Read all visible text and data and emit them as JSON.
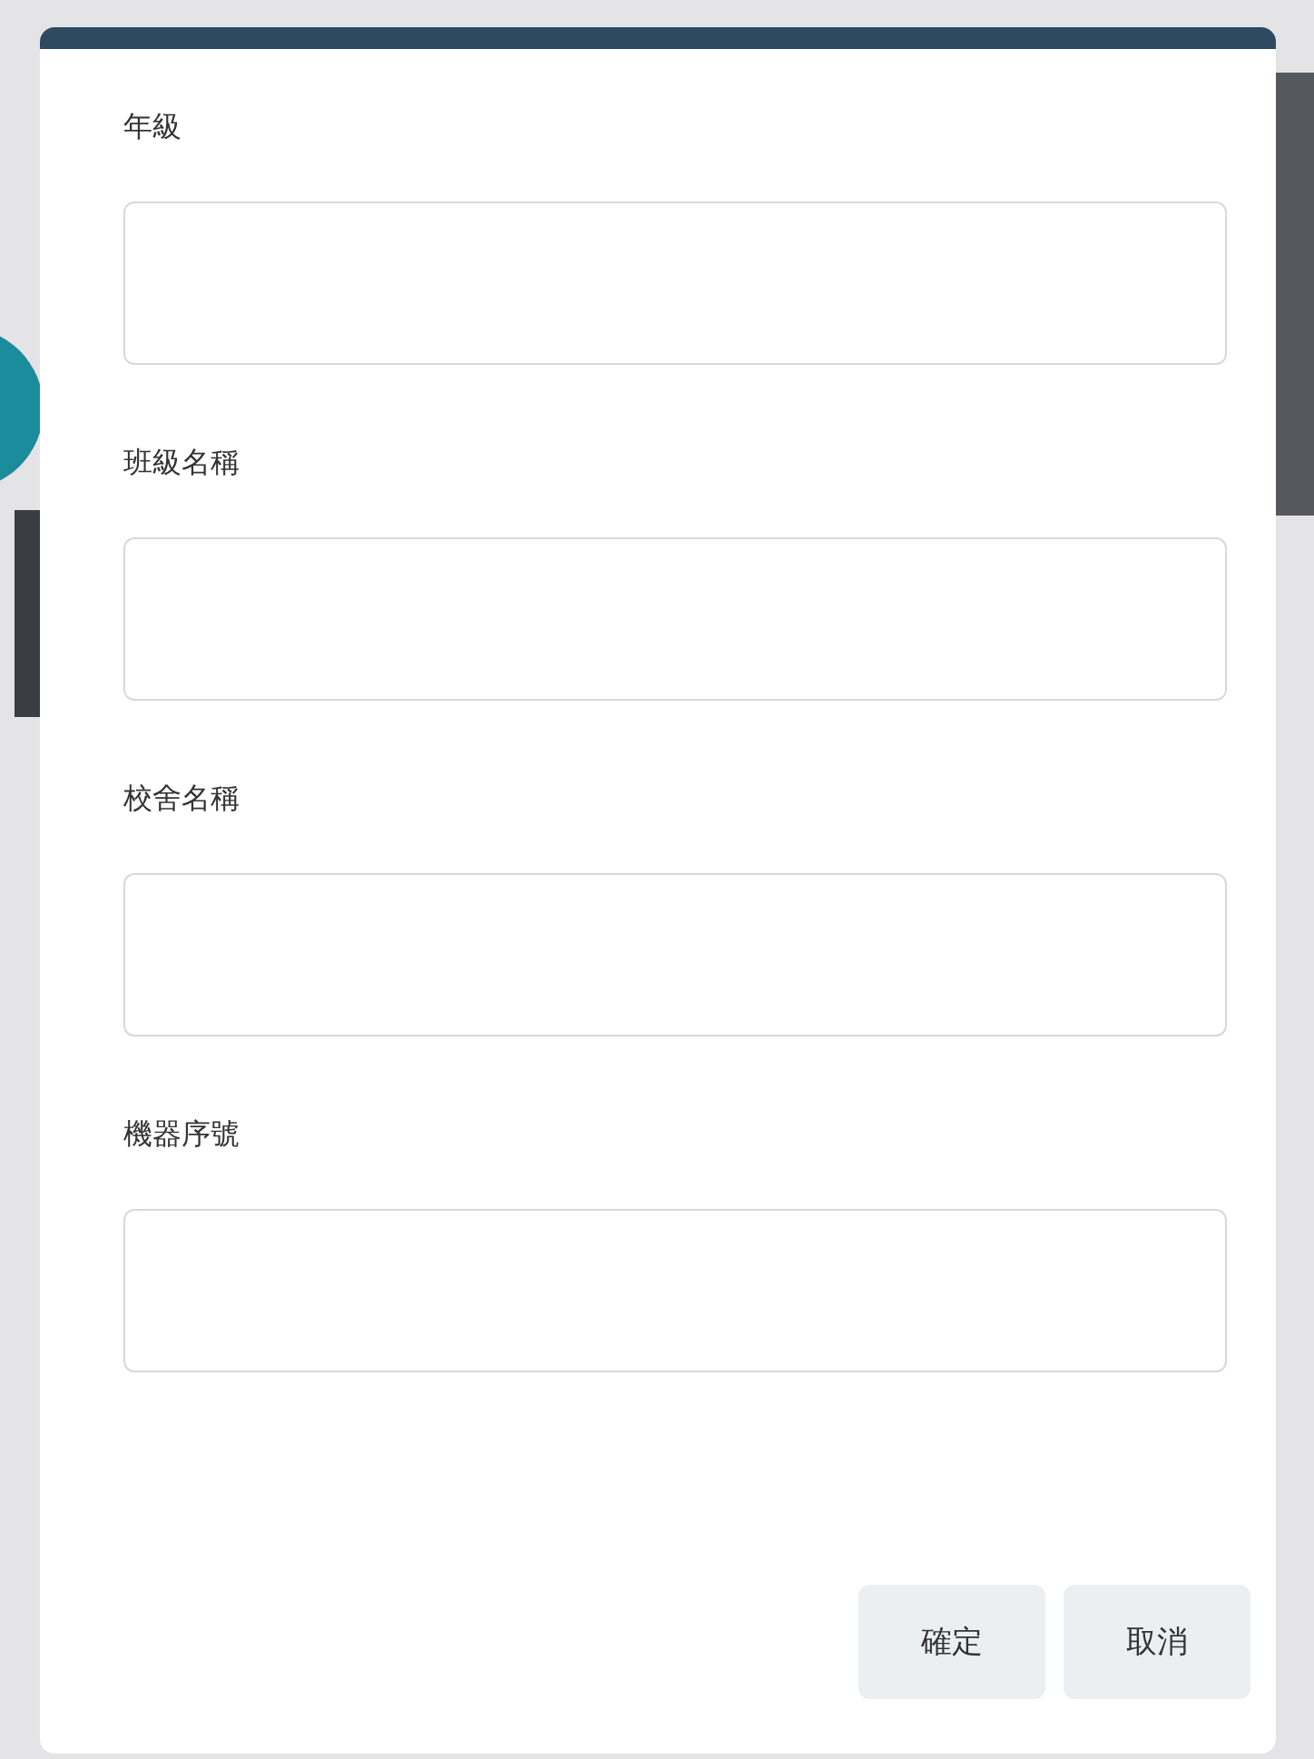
{
  "dialog": {
    "fields": [
      {
        "label": "年級"
      },
      {
        "label": "班級名稱"
      },
      {
        "label": "校舍名稱"
      },
      {
        "label": "機器序號"
      }
    ],
    "buttons": [
      "確定",
      "取消"
    ]
  }
}
